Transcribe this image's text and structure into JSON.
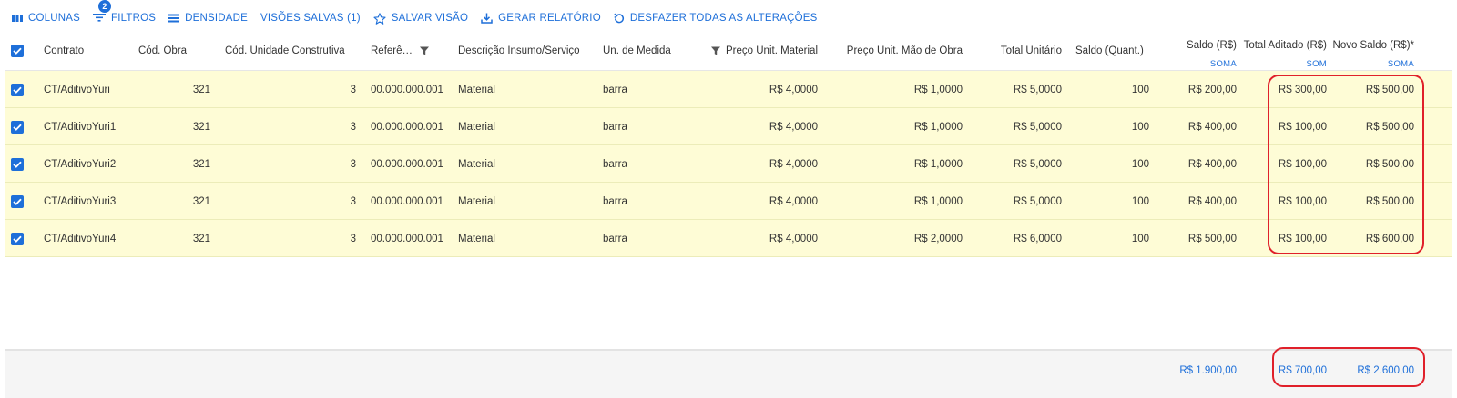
{
  "toolbar": {
    "columns_label": "COLUNAS",
    "filters_label": "FILTROS",
    "filters_count": "2",
    "density_label": "DENSIDADE",
    "saved_views_label": "VISÕES SALVAS (1)",
    "save_view_label": "SALVAR VISÃO",
    "report_label": "GERAR RELATÓRIO",
    "undo_all_label": "DESFAZER TODAS AS ALTERAÇÕES"
  },
  "columns": {
    "contrato": "Contrato",
    "cod_obra": "Cód. Obra",
    "cod_unidade": "Cód. Unidade Construtiva",
    "referencia": "Referê…",
    "descricao": "Descrição Insumo/Serviço",
    "un_medida": "Un. de Medida",
    "preco_material": "Preço Unit. Material",
    "preco_mao_obra": "Preço Unit. Mão de Obra",
    "total_unitario": "Total Unitário",
    "saldo_quant": "Saldo (Quant.)",
    "saldo_rs": "Saldo (R$)",
    "total_aditado": "Total Aditado (R$)",
    "novo_saldo": "Novo Saldo (R$)*",
    "saldo_rs_agg": "SOMA",
    "total_aditado_agg": "SOM",
    "novo_saldo_agg": "SOMA"
  },
  "rows": [
    {
      "contrato": "CT/AditivoYuri",
      "cod_obra": "321",
      "cod_unidade": "3",
      "referencia": "00.000.000.001",
      "descricao": "Material",
      "un_medida": "barra",
      "preco_material": "R$ 4,0000",
      "preco_mao_obra": "R$ 1,0000",
      "total_unitario": "R$ 5,0000",
      "saldo_quant": "100",
      "saldo_rs": "R$ 200,00",
      "total_aditado": "R$ 300,00",
      "novo_saldo": "R$ 500,00",
      "selected": true
    },
    {
      "contrato": "CT/AditivoYuri1",
      "cod_obra": "321",
      "cod_unidade": "3",
      "referencia": "00.000.000.001",
      "descricao": "Material",
      "un_medida": "barra",
      "preco_material": "R$ 4,0000",
      "preco_mao_obra": "R$ 1,0000",
      "total_unitario": "R$ 5,0000",
      "saldo_quant": "100",
      "saldo_rs": "R$ 400,00",
      "total_aditado": "R$ 100,00",
      "novo_saldo": "R$ 500,00",
      "selected": true
    },
    {
      "contrato": "CT/AditivoYuri2",
      "cod_obra": "321",
      "cod_unidade": "3",
      "referencia": "00.000.000.001",
      "descricao": "Material",
      "un_medida": "barra",
      "preco_material": "R$ 4,0000",
      "preco_mao_obra": "R$ 1,0000",
      "total_unitario": "R$ 5,0000",
      "saldo_quant": "100",
      "saldo_rs": "R$ 400,00",
      "total_aditado": "R$ 100,00",
      "novo_saldo": "R$ 500,00",
      "selected": true
    },
    {
      "contrato": "CT/AditivoYuri3",
      "cod_obra": "321",
      "cod_unidade": "3",
      "referencia": "00.000.000.001",
      "descricao": "Material",
      "un_medida": "barra",
      "preco_material": "R$ 4,0000",
      "preco_mao_obra": "R$ 1,0000",
      "total_unitario": "R$ 5,0000",
      "saldo_quant": "100",
      "saldo_rs": "R$ 400,00",
      "total_aditado": "R$ 100,00",
      "novo_saldo": "R$ 500,00",
      "selected": true
    },
    {
      "contrato": "CT/AditivoYuri4",
      "cod_obra": "321",
      "cod_unidade": "3",
      "referencia": "00.000.000.001",
      "descricao": "Material",
      "un_medida": "barra",
      "preco_material": "R$ 4,0000",
      "preco_mao_obra": "R$ 2,0000",
      "total_unitario": "R$ 6,0000",
      "saldo_quant": "100",
      "saldo_rs": "R$ 500,00",
      "total_aditado": "R$ 100,00",
      "novo_saldo": "R$ 600,00",
      "selected": true
    }
  ],
  "totals": {
    "saldo_rs": "R$ 1.900,00",
    "total_aditado": "R$ 700,00",
    "novo_saldo": "R$ 2.600,00"
  },
  "colors": {
    "accent": "#1e6fd9",
    "edited_row": "#fefcd6",
    "annotation": "#e0202a"
  }
}
